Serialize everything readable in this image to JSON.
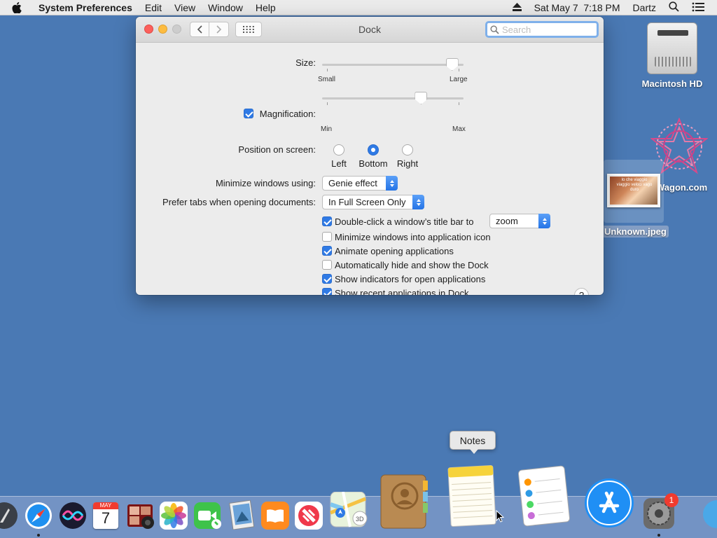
{
  "menubar": {
    "app_name": "System Preferences",
    "items": [
      "Edit",
      "View",
      "Window",
      "Help"
    ],
    "datetime": "Sat May 7  7:18 PM",
    "user": "Dartz"
  },
  "desktop": {
    "hd_label": "Macintosh HD",
    "wagon_label": "Wagon.com",
    "jpeg_label": "Unknown.jpeg",
    "jpeg_caption": "lo che viaggio viaggio veloci vago duro"
  },
  "window": {
    "title": "Dock",
    "search_placeholder": "Search"
  },
  "prefs": {
    "size_label": "Size:",
    "size_min": "Small",
    "size_max": "Large",
    "size_value": 0.96,
    "magnification_label": "Magnification:",
    "magnification_checked": true,
    "mag_min": "Min",
    "mag_max": "Max",
    "mag_value": 0.72,
    "position_label": "Position on screen:",
    "position_options": [
      "Left",
      "Bottom",
      "Right"
    ],
    "position_selected": "Bottom",
    "minimize_label": "Minimize windows using:",
    "minimize_value": "Genie effect",
    "tabs_label": "Prefer tabs when opening documents:",
    "tabs_value": "In Full Screen Only",
    "double_click_label": "Double-click a window’s title bar to",
    "double_click_value": "zoom",
    "checkboxes": [
      {
        "label": "Double-click a window’s title bar to",
        "checked": true
      },
      {
        "label": "Minimize windows into application icon",
        "checked": false
      },
      {
        "label": "Animate opening applications",
        "checked": true
      },
      {
        "label": "Automatically hide and show the Dock",
        "checked": false
      },
      {
        "label": "Show indicators for open applications",
        "checked": true
      },
      {
        "label": "Show recent applications in Dock",
        "checked": true
      }
    ],
    "help": "?"
  },
  "dock": {
    "tooltip": "Notes",
    "calendar_month": "MAY",
    "calendar_day": "7",
    "badge_count": "1",
    "items": [
      "launchpad-icon",
      "safari-icon",
      "siri-icon",
      "calendar-icon",
      "photo-booth-icon",
      "photos-icon",
      "facetime-icon",
      "preview-icon",
      "books-icon",
      "news-icon",
      "maps-icon",
      "contacts-icon",
      "notes-icon",
      "reminders-icon",
      "app-store-icon",
      "system-preferences-icon"
    ]
  },
  "colors": {
    "desktop": "#4a79b4",
    "accent": "#2f7ae5",
    "close": "#fc605c",
    "minimize": "#fdbc40"
  }
}
